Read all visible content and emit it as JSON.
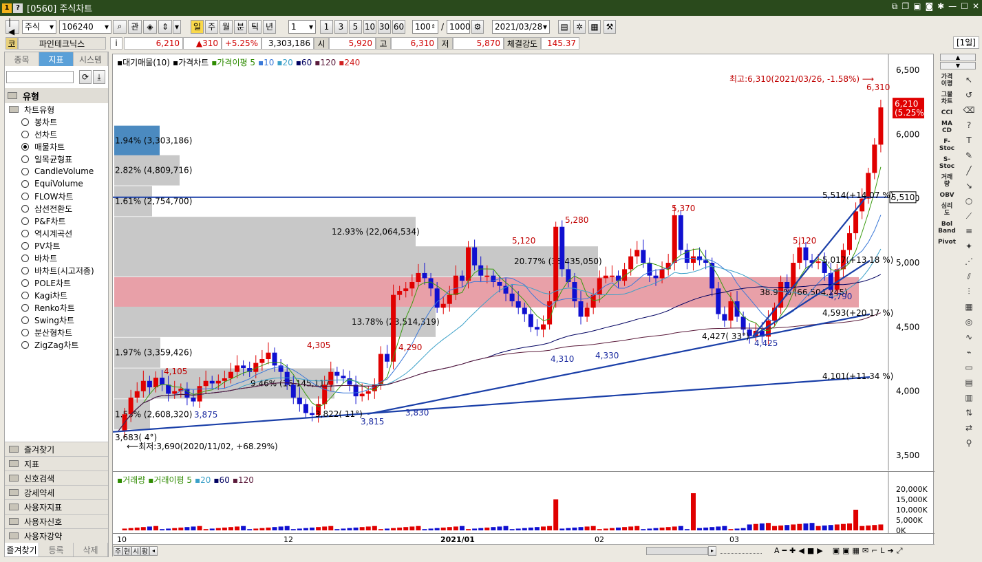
{
  "window": {
    "title": "[0560] 주식차트",
    "icon1": "1",
    "icon2": "?"
  },
  "toolbar": {
    "market": "주식",
    "code": "106240",
    "btn_gwan": "관",
    "periods": [
      "일",
      "주",
      "월",
      "분",
      "틱",
      "년"
    ],
    "active_period": "일",
    "interval": "1",
    "quick": [
      "1",
      "3",
      "5",
      "10",
      "30",
      "60"
    ],
    "count": "100",
    "slash": "/",
    "total": "1000",
    "date": "2021/03/28"
  },
  "info": {
    "market_tag": "코",
    "name": "파인테크닉스",
    "i": "i",
    "price": "6,210",
    "change": "▲310",
    "pct": "+5.25%",
    "volume": "3,303,186",
    "open_label": "시",
    "open": "5,920",
    "high_label": "고",
    "high": "6,310",
    "low_label": "저",
    "low": "5,870",
    "strength_label": "체결강도",
    "strength": "145.37",
    "badge": "[1일]"
  },
  "left": {
    "tabs": [
      "종목",
      "지표",
      "시스템"
    ],
    "active_tab": "지표",
    "section": "유형",
    "subsection": "차트유형",
    "items": [
      "봉차트",
      "선차트",
      "매물차트",
      "일목균형표",
      "CandleVolume",
      "EquiVolume",
      "FLOW차트",
      "삼선전환도",
      "P&F차트",
      "역시계곡선",
      "PV차트",
      "바차트",
      "바차트(시고저종)",
      "POLE차트",
      "Kagi차트",
      "Renko차트",
      "Swing차트",
      "분산형차트",
      "ZigZag차트"
    ],
    "selected": "매물차트",
    "groups": [
      "즐겨찾기",
      "지표",
      "신호검색",
      "강세약세",
      "사용자지표",
      "사용자신호",
      "사용자강약"
    ],
    "bottom_tabs": [
      "즐겨찾기",
      "등록",
      "삭제"
    ]
  },
  "price_legend": {
    "items": [
      {
        "text": "대기매물(10)",
        "color": "#000000"
      },
      {
        "text": "가격차트",
        "color": "#000000"
      },
      {
        "text": "가격이평 5",
        "color": "#2e8b00"
      },
      {
        "text": "10",
        "color": "#3a78d8"
      },
      {
        "text": "20",
        "color": "#3aa0c8"
      },
      {
        "text": "60",
        "color": "#000060"
      },
      {
        "text": "120",
        "color": "#5a1a3a"
      },
      {
        "text": "240",
        "color": "#d02020"
      }
    ]
  },
  "volume_legend": {
    "items": [
      {
        "text": "거래량",
        "color": "#2e8b00"
      },
      {
        "text": "거래이평 5",
        "color": "#2e8b00"
      },
      {
        "text": "20",
        "color": "#3aa0c8"
      },
      {
        "text": "60",
        "color": "#000060"
      },
      {
        "text": "120",
        "color": "#5a1a3a"
      }
    ]
  },
  "annotations": {
    "high_note": "최고:6,310(2021/03/26, -1.58%)",
    "low_note": "최저:3,690(2020/11/02, +68.29%)",
    "current_tag": "6,210",
    "current_pct": "(5.25%)",
    "line_tag": "5,510",
    "peak_labels": [
      "4,105",
      "4,305",
      "4,290",
      "5,120",
      "5,280",
      "5,370",
      "5,120",
      "6,310"
    ],
    "trough_labels": [
      "3,875",
      "3,815",
      "3,830",
      "4,310",
      "4,330",
      "4,425",
      "4,790"
    ],
    "trend_labels": [
      "3,683(  4°)",
      "3,822(  11°)",
      "4,427(  33°)",
      "4,593(+20.17 %)",
      "4,101(+11.34 %)",
      "5,514(+14.07 %)",
      "5,017(+13.18 %)"
    ]
  },
  "chart_data": {
    "type": "candlestick-volume-profile",
    "y_axis": [
      6500,
      6000,
      5500,
      5000,
      4500,
      4000,
      3500
    ],
    "y_tick_labels": [
      "6,500",
      "6,000",
      "5,500",
      "5,000",
      "4,500",
      "4,000",
      "3,500"
    ],
    "volume_axis": [
      "20,000K",
      "15,000K",
      "10,000K",
      "5,000K",
      "0K"
    ],
    "x_labels": [
      "10",
      "12",
      "2021/01",
      "02",
      "03"
    ],
    "volume_profile": [
      {
        "price_mid": 5950,
        "pct": "1.94%",
        "vol": "3,303,186",
        "highlight": "current"
      },
      {
        "price_mid": 5720,
        "pct": "2.82%",
        "vol": "4,809,716"
      },
      {
        "price_mid": 5480,
        "pct": "1.61%",
        "vol": "2,754,700"
      },
      {
        "price_mid": 5240,
        "pct": "12.93%",
        "vol": "22,064,534"
      },
      {
        "price_mid": 5010,
        "pct": "20.77%",
        "vol": "35,435,050"
      },
      {
        "price_mid": 4770,
        "pct": "38.97%",
        "vol": "66,504,245",
        "highlight": "max"
      },
      {
        "price_mid": 4540,
        "pct": "13.78%",
        "vol": "23,514,319"
      },
      {
        "price_mid": 4300,
        "pct": "1.97%",
        "vol": "3,359,426"
      },
      {
        "price_mid": 4060,
        "pct": "9.46%",
        "vol": "16,145,117"
      },
      {
        "price_mid": 3820,
        "pct": "1.53%",
        "vol": "2,608,320"
      }
    ]
  },
  "bottom_controls": [
    "주",
    "현",
    "시",
    "황"
  ]
}
